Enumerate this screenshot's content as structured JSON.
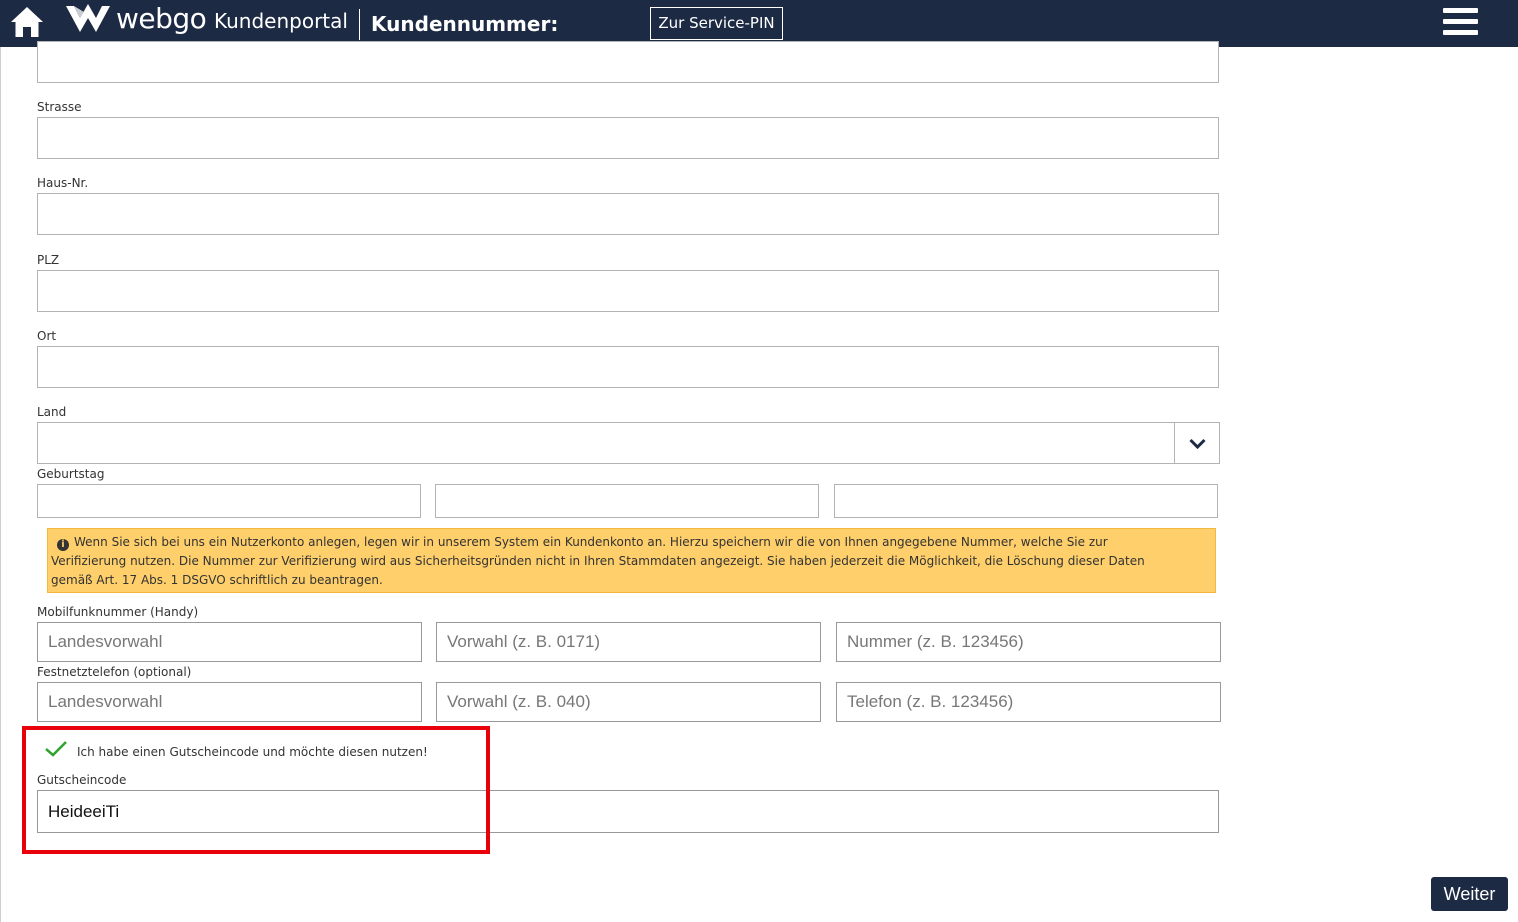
{
  "header": {
    "brand": "webgo",
    "brand_sub": "Kundenportal",
    "customer_number_label": "Kundennummer:",
    "service_pin_button": "Zur Service-PIN"
  },
  "form": {
    "street_label": "Strasse",
    "house_number_label": "Haus-Nr.",
    "zip_label": "PLZ",
    "city_label": "Ort",
    "country_label": "Land",
    "birthday_label": "Geburtstag",
    "notice_text": "Wenn Sie sich bei uns ein Nutzerkonto anlegen, legen wir in unserem System ein Kundenkonto an. Hierzu speichern wir die von Ihnen angegebene Nummer, welche Sie zur Verifizierung nutzen. Die Nummer zur Verifizierung wird aus Sicherheitsgründen nicht in Ihren Stammdaten angezeigt. Sie haben jederzeit die Möglichkeit, die Löschung dieser Daten gemäß Art. 17 Abs. 1 DSGVO schriftlich zu beantragen.",
    "mobile_label": "Mobilfunknummer (Handy)",
    "mobile_country_placeholder": "Landesvorwahl",
    "mobile_area_placeholder": "Vorwahl (z. B. 0171)",
    "mobile_number_placeholder": "Nummer (z. B. 123456)",
    "landline_label": "Festnetztelefon (optional)",
    "landline_country_placeholder": "Landesvorwahl",
    "landline_area_placeholder": "Vorwahl (z. B. 040)",
    "landline_number_placeholder": "Telefon (z. B. 123456)",
    "voucher_checkbox_label": "Ich habe einen Gutscheincode und möchte diesen nutzen!",
    "voucher_checked": true,
    "voucher_code_label": "Gutscheincode",
    "voucher_code_value": "HeideeiTi"
  },
  "footer": {
    "next_button": "Weiter"
  },
  "colors": {
    "header_bg": "#1d2a44",
    "notice_bg": "#fecf6a",
    "highlight": "#e8000b",
    "check": "#2ea32e"
  }
}
